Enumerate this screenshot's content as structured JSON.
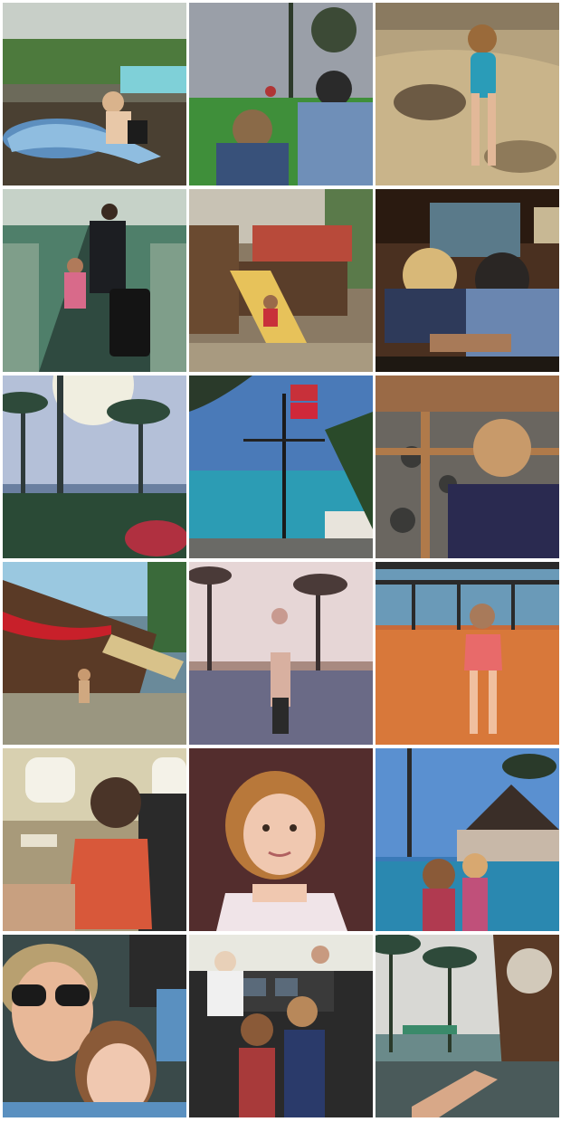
{
  "collage": {
    "rows": 6,
    "columns": 3,
    "background": "#ffffff",
    "photos": [
      {
        "subject": "boy-on-dolphin-slide"
      },
      {
        "subject": "dad-and-kids-on-lawn"
      },
      {
        "subject": "toddler-in-tide-pool"
      },
      {
        "subject": "airport-moving-walkway"
      },
      {
        "subject": "pirate-ship-slide"
      },
      {
        "subject": "dad-and-son-in-restaurant"
      },
      {
        "subject": "palm-trees-sun-flare"
      },
      {
        "subject": "flagpole-over-ocean"
      },
      {
        "subject": "boy-looking-at-rocks"
      },
      {
        "subject": "pirate-ship-wading-pool"
      },
      {
        "subject": "man-lifting-child-by-pool"
      },
      {
        "subject": "girl-at-railing"
      },
      {
        "subject": "girl-at-plane-window"
      },
      {
        "subject": "girl-portrait"
      },
      {
        "subject": "kids-by-pool-hut"
      },
      {
        "subject": "mother-daughter-selfie"
      },
      {
        "subject": "kids-in-cockpit"
      },
      {
        "subject": "feet-by-pool-palms"
      }
    ]
  }
}
